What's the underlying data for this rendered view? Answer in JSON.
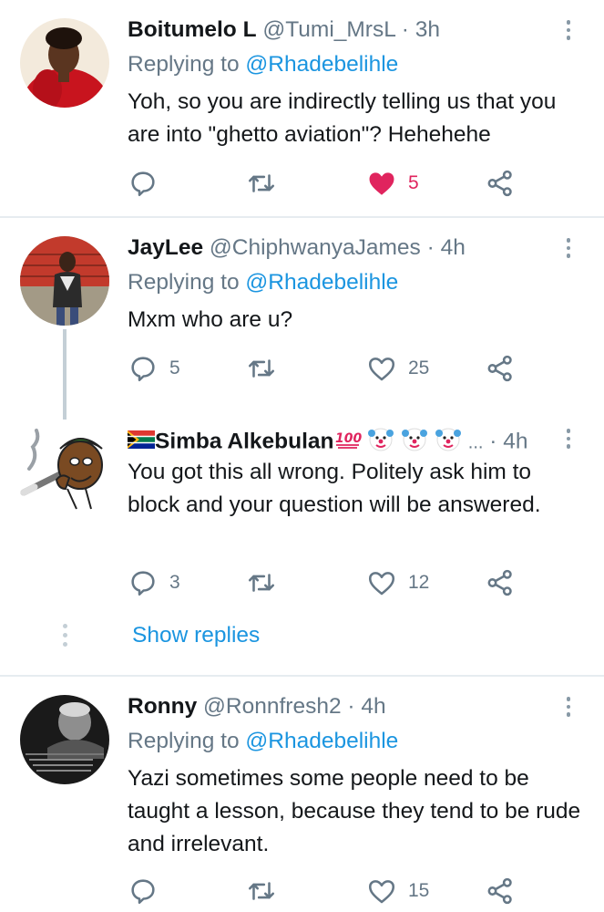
{
  "tweets": [
    {
      "name": "Boitumelo L",
      "handle": "@Tumi_MrsL",
      "dot": "·",
      "time": "3h",
      "replying_label": "Replying to",
      "replying_to": "@Rhadebelihle",
      "text": "Yoh, so you are indirectly telling us that you are into \"ghetto aviation\"? Hehehehe",
      "reply_count": "",
      "retweet_count": "",
      "like_count": "5",
      "liked": true
    },
    {
      "name": "JayLee",
      "handle": "@ChiphwanyaJames",
      "dot": "·",
      "time": "4h",
      "replying_label": "Replying to",
      "replying_to": "@Rhadebelihle",
      "text": "Mxm who are u?",
      "reply_count": "5",
      "retweet_count": "",
      "like_count": "25",
      "liked": false
    },
    {
      "name": "Simba Alkebulan",
      "name_suffix_emojis": [
        "flag-south-africa",
        "hundred-points",
        "clown-face",
        "clown-face",
        "clown-face"
      ],
      "handle": "...",
      "dot": "·",
      "time": "4h",
      "text": "You got this all wrong. Politely ask him to block and your question will be answered.",
      "reply_count": "3",
      "retweet_count": "",
      "like_count": "12",
      "liked": false
    },
    {
      "name": "Ronny",
      "handle": "@Ronnfresh2",
      "dot": "·",
      "time": "4h",
      "replying_label": "Replying to",
      "replying_to": "@Rhadebelihle",
      "text": "Yazi sometimes some people need to be taught a lesson, because they tend to be rude and irrelevant.",
      "reply_count": "",
      "retweet_count": "",
      "like_count": "15",
      "liked": false
    }
  ],
  "show_replies_label": "Show replies",
  "colors": {
    "link_blue": "#1b95e0",
    "secondary_gray": "#657786",
    "like_red": "#e0245e",
    "divider": "#e6ecf0"
  },
  "icons": [
    "reply-icon",
    "retweet-icon",
    "like-icon",
    "share-icon",
    "more-options-icon"
  ]
}
